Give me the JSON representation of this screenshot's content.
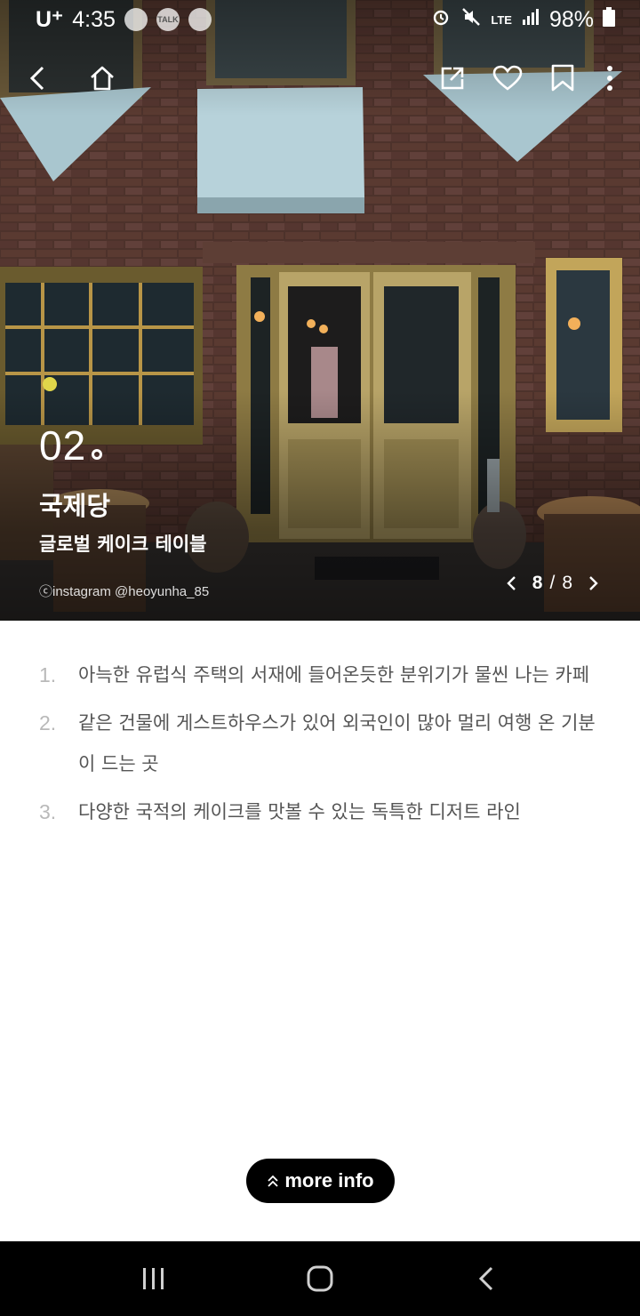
{
  "status_bar": {
    "carrier": "U⁺",
    "time": "4:35",
    "talk_badge": "TALK",
    "network": "LTE",
    "battery": "98%"
  },
  "nav": {
    "back_icon": "chevron-left-icon",
    "home_icon": "home-icon",
    "share_icon": "share-icon",
    "like_icon": "heart-icon",
    "bookmark_icon": "bookmark-icon",
    "more_icon": "more-vertical-icon"
  },
  "hero": {
    "number": "02",
    "title": "국제당",
    "subtitle": "글로벌 케이크 테이블",
    "credit": "ⓒinstagram @heoyunha_85",
    "pager": {
      "current": "8",
      "separator": "/",
      "total": "8"
    }
  },
  "features": [
    {
      "num": "1.",
      "text": "아늑한 유럽식 주택의 서재에 들어온듯한 분위기가 물씬 나는 카페"
    },
    {
      "num": "2.",
      "text": "같은 건물에 게스트하우스가 있어 외국인이 많아 멀리 여행 온 기분이 드는 곳"
    },
    {
      "num": "3.",
      "text": "다양한 국적의 케이크를 맛볼 수 있는 독특한 디저트 라인"
    }
  ],
  "more_info": {
    "label": "more info"
  },
  "system_nav": {
    "recents_icon": "recents-icon",
    "home_icon": "home-circle-icon",
    "back_icon": "back-icon"
  }
}
